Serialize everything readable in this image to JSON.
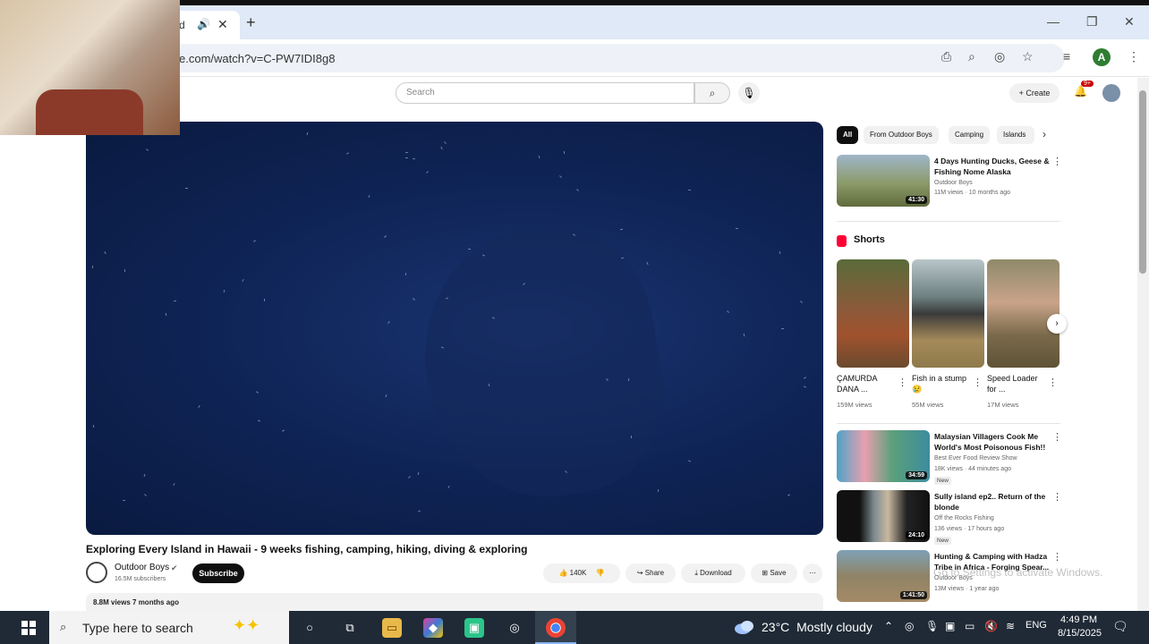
{
  "browser": {
    "tab_title": "d",
    "url": "e.com/watch?v=C-PW7IDI8g8",
    "profile_initial": "A"
  },
  "youtube": {
    "search_placeholder": "Search",
    "create_label": "Create",
    "notifications_badge": "9+",
    "video": {
      "title": "Exploring Every Island in Hawaii - 9 weeks fishing, camping, hiking, diving & exploring",
      "channel": "Outdoor Boys",
      "subscribers": "16.5M subscribers",
      "subscribe_label": "Subscribe",
      "likes": "140K",
      "share_label": "Share",
      "download_label": "Download",
      "save_label": "Save",
      "description_meta": "8.8M views  7 months ago"
    },
    "chips": [
      "All",
      "From Outdoor Boys",
      "Camping",
      "Islands"
    ],
    "recommended_top": {
      "title": "4 Days Hunting Ducks, Geese & Fishing Nome Alaska",
      "channel": "Outdoor Boys",
      "meta": "11M views · 10 months ago",
      "duration": "41:30"
    },
    "shorts_label": "Shorts",
    "shorts": [
      {
        "title": "ÇAMURDA DANA ...",
        "views": "159M views"
      },
      {
        "title": "Fish in a stump😢",
        "views": "55M views"
      },
      {
        "title": "Speed Loader for ...",
        "views": "17M views"
      }
    ],
    "recommended": [
      {
        "title": "Malaysian Villagers Cook Me World's Most Poisonous Fish!!",
        "channel": "Best Ever Food Review Show",
        "meta": "18K views · 44 minutes ago",
        "badge": "New",
        "duration": "34:59"
      },
      {
        "title": "Sully island ep2.. Return of the blonde",
        "channel": "Off the Rocks Fishing",
        "meta": "136 views · 17 hours ago",
        "badge": "New",
        "duration": "24:10"
      },
      {
        "title": "Hunting & Camping with Hadza Tribe in Africa - Forging Spear...",
        "channel": "Outdoor Boys",
        "meta": "13M views · 1 year ago",
        "badge": "",
        "duration": "1:41:50"
      }
    ],
    "watermark_line1": "Activate Windows",
    "watermark_line2": "Go to Settings to activate Windows."
  },
  "taskbar": {
    "search_placeholder": "Type here to search",
    "weather_temp": "23°C",
    "weather_desc": "Mostly cloudy",
    "language": "ENG",
    "time": "4:49 PM",
    "date": "8/15/2025",
    "notifications": "7"
  },
  "icons": {
    "colors": {
      "youtube_red": "#ff0033",
      "chrome_tab_bg": "#dfe9f7",
      "taskbar": "#1f2a36"
    }
  }
}
